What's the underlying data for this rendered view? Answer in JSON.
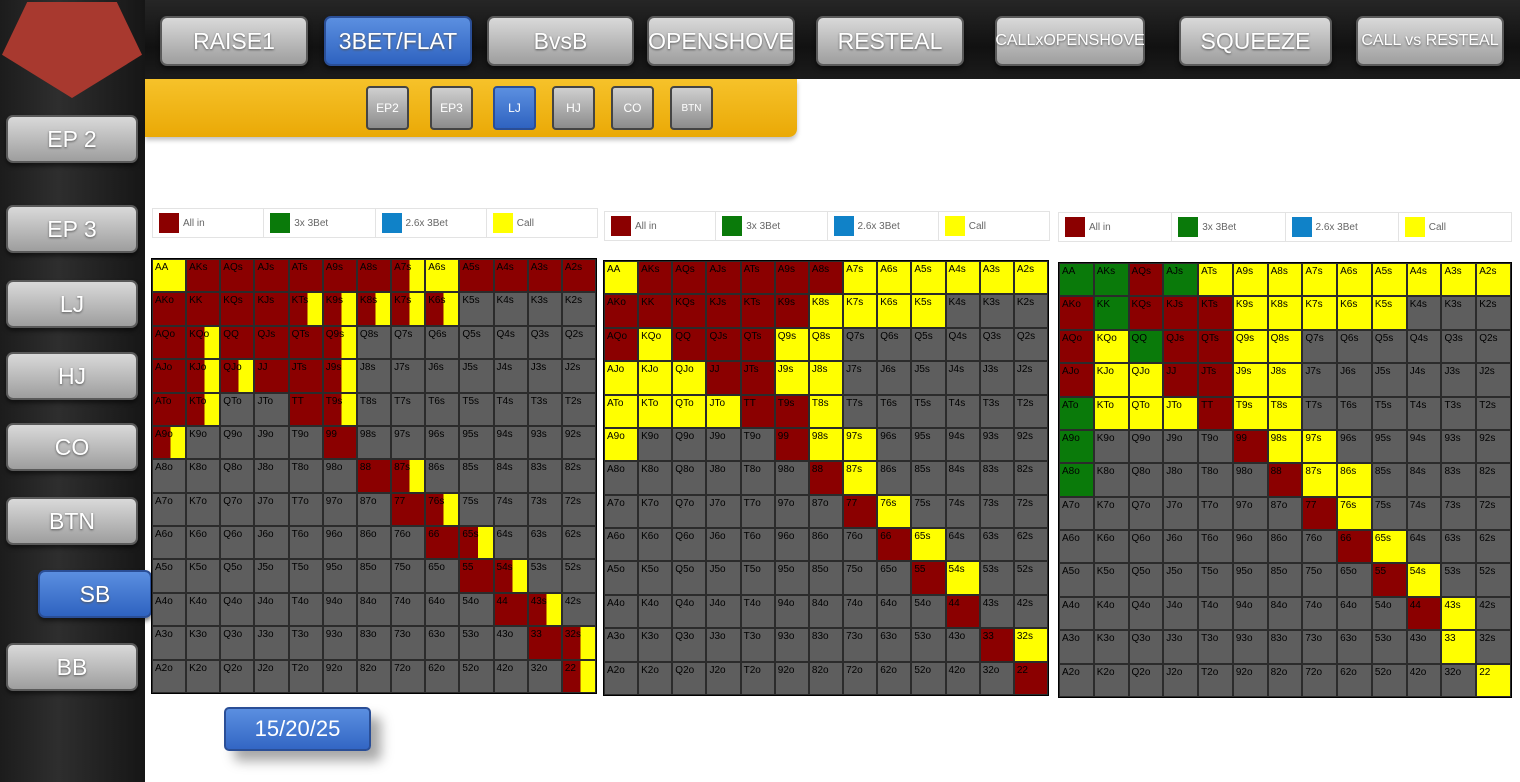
{
  "colors": {
    "all_in": "#8b0000",
    "bet3x": "#0a7a0a",
    "bet26": "#1082c8",
    "call": "#ffff00",
    "fold": "#5e5e5e"
  },
  "top_nav": [
    "RAISE1",
    "3BET/FLAT",
    "BvsB",
    "OPENSHOVE",
    "RESTEAL",
    "CALLxOPENSHOVE",
    "SQUEEZE",
    "CALL vs RESTEAL"
  ],
  "top_nav_active": "3BET/FLAT",
  "side_nav": [
    "EP 2",
    "EP 3",
    "LJ",
    "HJ",
    "CO",
    "BTN",
    "SB",
    "BB"
  ],
  "side_nav_active": "SB",
  "positions": [
    "EP2",
    "EP3",
    "LJ",
    "HJ",
    "CO",
    "BTN"
  ],
  "positions_active": "LJ",
  "legend": [
    "All in",
    "3x 3Bet",
    "2.6x 3Bet",
    "Call"
  ],
  "date_button": "15/20/25",
  "ranks": [
    "A",
    "K",
    "Q",
    "J",
    "T",
    "9",
    "8",
    "7",
    "6",
    "5",
    "4",
    "3",
    "2"
  ],
  "charts": [
    {
      "a": [
        "AA:aF,AKs:a,AQs:a,AJs:a,ATs:a,A9s:a,A8s:a,A5s:a,A4s:a,A3s:a,A2s:a,A7s:aS,A6s:aF,A7s:aS",
        "AKo:a,KK:a,KQs:a,KJs:a,KTs:aS,K9s:aS,K8s:aS,K7s:aS,K6s:aS",
        "AQo:a,KQo:aS,QQ:a,QJs:a,QTs:a,Q9s:aS",
        "AJo:a,KJo:aS,QJo:aS,JJ:a,JTs:a,J9s:aS",
        "ATo:a,KTo:aS,TT:a,T9s:aS",
        "A9o:aS,99:a",
        "88:a,87s:aS",
        "77:a,76s:aS",
        "66:a,65s:aS",
        "55:a,54s:aS",
        "44:a,43s:aS",
        "33:a,32s:aS",
        "22:aS"
      ]
    },
    {
      "a": [
        "AA:c,AKs:a,AQs:a,AJs:a,ATs:a,A9s:a,A8s:a,A7s:c,A6s:c,A5s:c,A4s:c,A3s:c,A2s:c",
        "AKo:a,KK:a,KQs:a,KJs:a,KTs:a,K9s:a,K8s:c,K7s:c,K6s:c,K5s:c",
        "AQo:a,KQo:c,QQ:a,QJs:a,QTs:a,Q9s:c,Q8s:c",
        "AJo:c,KJo:c,QJo:c,JJ:a,JTs:a,J9s:c,J8s:c",
        "ATo:c,KTo:c,QTo:c,JTo:c,TT:a,T9s:a,T8s:c",
        "A9o:c,99:a,98s:c,97s:c",
        "88:a,87s:c",
        "77:a,76s:c",
        "66:a,65s:c",
        "55:a,54s:c",
        "44:a",
        "33:a,32s:c",
        "22:a"
      ]
    },
    {
      "a": [
        "AA:g,AKs:g,AQs:a,AJs:g,ATs:c,A9s:c,A8s:c,A7s:c,A6s:c,A5s:c,A4s:c,A3s:c,A2s:c",
        "AKo:a,KK:g,KQs:a,KJs:a,KTs:a,K9s:c,K8s:c,K7s:c,K6s:c,K5s:c",
        "AQo:a,KQo:c,QQ:g,QJs:a,QTs:a,Q9s:c,Q8s:c",
        "AJo:a,KJo:c,QJo:c,JJ:a,JTs:a,J9s:c,J8s:c",
        "ATo:g,KTo:c,QTo:c,JTo:c,TT:a,T9s:c,T8s:c",
        "A9o:g,99:a,98s:c,97s:c",
        "A8o:g,88:a,87s:c,86s:c",
        "77:a,76s:c",
        "66:a,65s:c",
        "55:a,54s:c",
        "44:a,43s:c",
        "33:c",
        "22:c"
      ]
    }
  ]
}
